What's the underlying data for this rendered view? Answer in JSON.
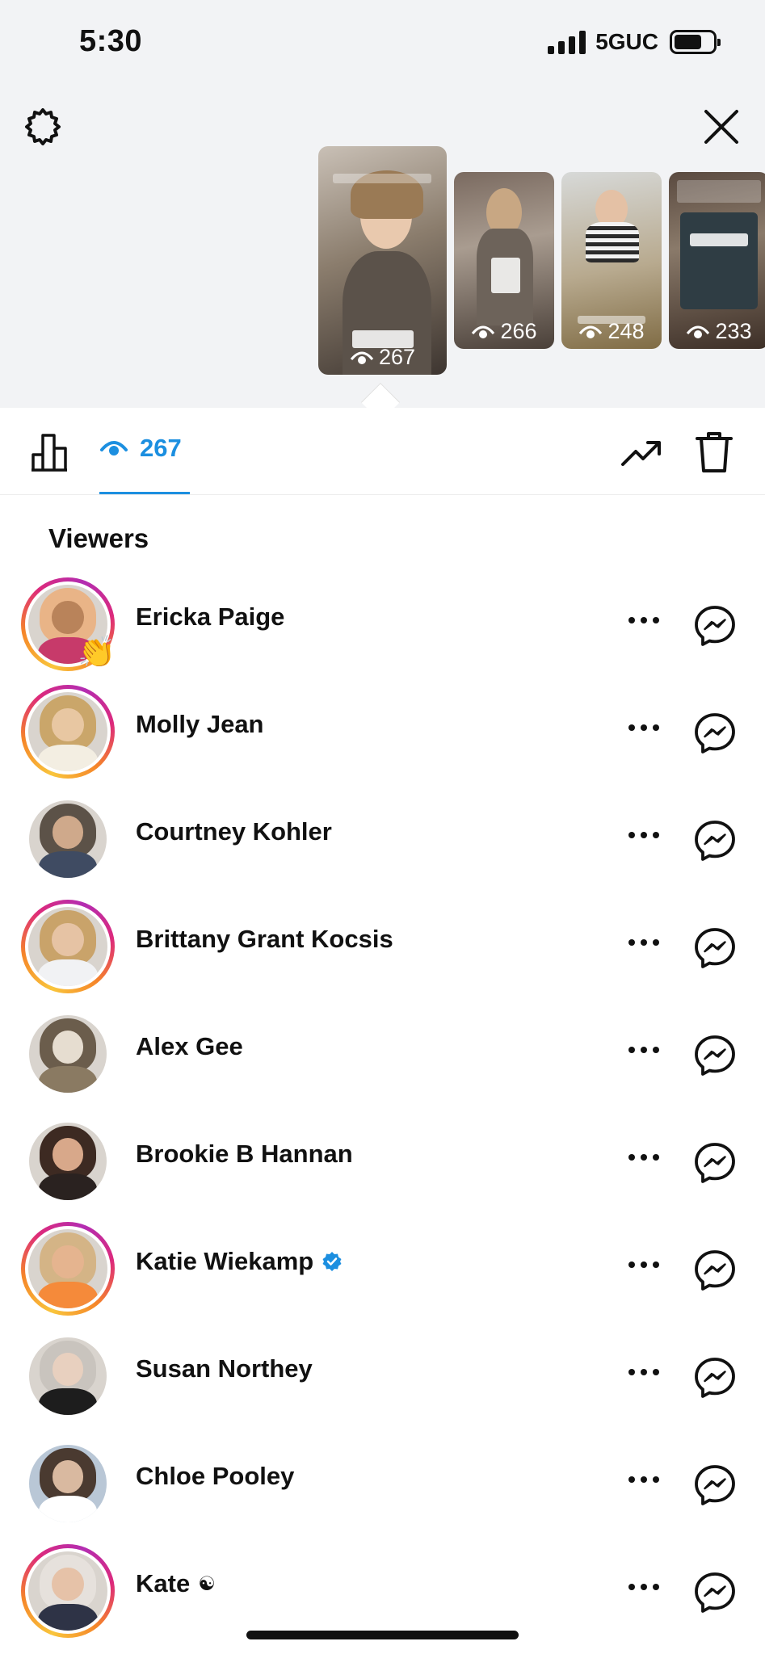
{
  "status_bar": {
    "time": "5:30",
    "network": "5GUC",
    "battery_percent": 72
  },
  "story_thumbnails": [
    {
      "views": "267",
      "caption_top": "...have in my room!!!",
      "caption_bottom": "So if we made it into my room at the Westerm and I got",
      "selected": true
    },
    {
      "views": "266",
      "selected": false
    },
    {
      "views": "248",
      "selected": false
    },
    {
      "views": "233",
      "selected": false
    }
  ],
  "toolbar": {
    "viewer_count": "267"
  },
  "viewers_heading": "Viewers",
  "viewers": [
    {
      "name": "Ericka Paige",
      "ring": true,
      "reaction": "👏",
      "verified": false,
      "colors": [
        "#e9b487",
        "#b9835a",
        "#c73a6a"
      ]
    },
    {
      "name": "Molly Jean",
      "ring": true,
      "reaction": "",
      "verified": false,
      "colors": [
        "#caa66a",
        "#e8c7a2",
        "#f3eee2"
      ]
    },
    {
      "name": "Courtney Kohler",
      "ring": false,
      "reaction": "",
      "verified": false,
      "colors": [
        "#5c5248",
        "#cfa98b",
        "#3f4b62"
      ]
    },
    {
      "name": "Brittany Grant Kocsis",
      "ring": true,
      "reaction": "",
      "verified": false,
      "colors": [
        "#c9a36a",
        "#e6c3a4",
        "#f1f2f4"
      ]
    },
    {
      "name": "Alex Gee",
      "ring": false,
      "reaction": "",
      "verified": false,
      "colors": [
        "#6b5d4c",
        "#e6ddd0",
        "#8a7a62"
      ]
    },
    {
      "name": "Brookie B Hannan",
      "ring": false,
      "reaction": "",
      "verified": false,
      "colors": [
        "#3d2a22",
        "#d8a88a",
        "#2a2220"
      ]
    },
    {
      "name": "Katie Wiekamp",
      "ring": true,
      "reaction": "",
      "verified": true,
      "colors": [
        "#d4b486",
        "#e5b48f",
        "#f58a3a"
      ]
    },
    {
      "name": "Susan Northey",
      "ring": false,
      "reaction": "",
      "verified": false,
      "colors": [
        "#c9c4be",
        "#e8d0bf",
        "#1d1d1d"
      ]
    },
    {
      "name": "Chloe Pooley",
      "ring": false,
      "reaction": "",
      "verified": false,
      "colors": [
        "#4a3a30",
        "#d9b9a0",
        "#ffffff"
      ]
    },
    {
      "name": "Kate",
      "ring": true,
      "reaction": "",
      "verified": false,
      "suffix": "☯",
      "colors": [
        "#e6e1dc",
        "#e6c2a8",
        "#2e3346"
      ]
    }
  ],
  "accent_color": "#1c8fe0",
  "icons": [
    "gear-icon",
    "close-icon",
    "bar-chart-icon",
    "eye-icon",
    "trend-icon",
    "trash-icon",
    "more-icon",
    "messenger-icon",
    "verified-icon"
  ]
}
